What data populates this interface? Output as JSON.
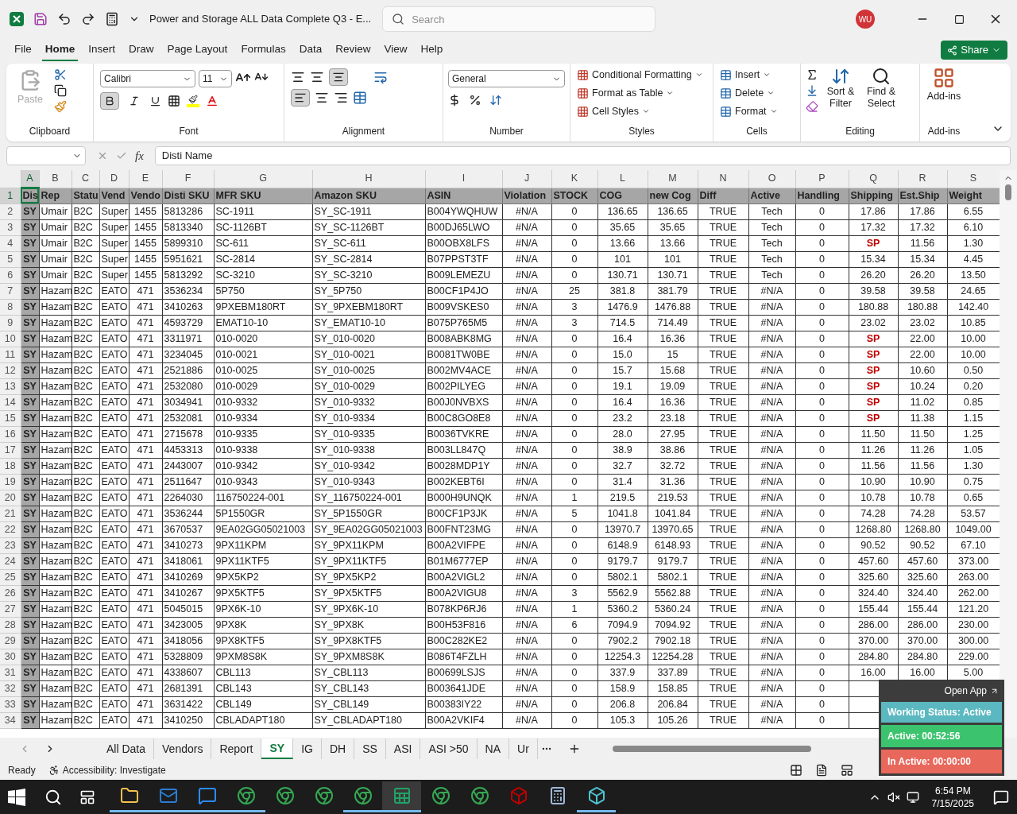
{
  "title_bar": {
    "document_title": "Power and Storage ALL Data Complete Q3  -  E...",
    "search_placeholder": "Search",
    "user_initials": "WU"
  },
  "menu_tabs": [
    {
      "label": "File",
      "selected": false
    },
    {
      "label": "Home",
      "selected": true
    },
    {
      "label": "Insert",
      "selected": false
    },
    {
      "label": "Draw",
      "selected": false
    },
    {
      "label": "Page Layout",
      "selected": false
    },
    {
      "label": "Formulas",
      "selected": false
    },
    {
      "label": "Data",
      "selected": false
    },
    {
      "label": "Review",
      "selected": false
    },
    {
      "label": "View",
      "selected": false
    },
    {
      "label": "Help",
      "selected": false
    }
  ],
  "share_button": "Share",
  "ribbon": {
    "paste": {
      "label": "Paste",
      "disabled": true
    },
    "font_name": "Calibri",
    "font_size": "11",
    "bold": true,
    "italic": false,
    "align_left": true,
    "align_bottom": true,
    "number_format": "General",
    "styles": [
      "Conditional Formatting",
      "Format as Table",
      "Cell Styles"
    ],
    "cells": [
      "Insert",
      "Delete",
      "Format"
    ],
    "sort_filter": "Sort & Filter",
    "find_select": "Find & Select",
    "addins": "Add-ins",
    "groups": [
      "Clipboard",
      "Font",
      "Alignment",
      "Number",
      "Styles",
      "Cells",
      "Editing",
      "Add-ins"
    ]
  },
  "formula_bar": {
    "function_label": "fx",
    "content": "Disti Name"
  },
  "columns": [
    {
      "label": "A",
      "selected": true
    },
    {
      "label": "B",
      "selected": false
    },
    {
      "label": "C",
      "selected": false
    },
    {
      "label": "D",
      "selected": false
    },
    {
      "label": "E",
      "selected": false
    },
    {
      "label": "F",
      "selected": false
    },
    {
      "label": "G",
      "selected": false
    },
    {
      "label": "H",
      "selected": false
    },
    {
      "label": "I",
      "selected": false
    },
    {
      "label": "J",
      "selected": false
    },
    {
      "label": "K",
      "selected": false
    },
    {
      "label": "L",
      "selected": false
    },
    {
      "label": "M",
      "selected": false
    },
    {
      "label": "N",
      "selected": false
    },
    {
      "label": "O",
      "selected": false
    },
    {
      "label": "P",
      "selected": false
    },
    {
      "label": "Q",
      "selected": false
    },
    {
      "label": "R",
      "selected": false
    },
    {
      "label": "S",
      "selected": false
    }
  ],
  "header_row": {
    "number": "1",
    "selected": true,
    "cells": [
      "Dis",
      "Rep",
      "Statu",
      "Vend",
      "Vendo",
      "Disti SKU",
      "MFR SKU",
      "Amazon SKU",
      "ASIN",
      "Violation",
      "STOCK",
      "COG",
      "new Cog",
      "Diff",
      "Active",
      "Handling",
      "Shipping",
      "Est.Ship",
      "Weight"
    ]
  },
  "rows": [
    {
      "number": "2",
      "shipping_flag": false,
      "cells": [
        "SY",
        "Umair",
        "B2C",
        "Super",
        "1455",
        "5813286",
        "SC-1911",
        "SY_SC-1911",
        "B004YWQHUW",
        "#N/A",
        "0",
        "136.65",
        "136.65",
        "TRUE",
        "Tech",
        "0",
        "17.86",
        "17.86",
        "6.55"
      ]
    },
    {
      "number": "3",
      "shipping_flag": false,
      "cells": [
        "SY",
        "Umair",
        "B2C",
        "Super",
        "1455",
        "5813340",
        "SC-1126BT",
        "SY_SC-1126BT",
        "B00DJ65LWO",
        "#N/A",
        "0",
        "35.65",
        "35.65",
        "TRUE",
        "Tech",
        "0",
        "17.32",
        "17.32",
        "6.10"
      ]
    },
    {
      "number": "4",
      "shipping_flag": true,
      "cells": [
        "SY",
        "Umair",
        "B2C",
        "Super",
        "1455",
        "5899310",
        "SC-611",
        "SY_SC-611",
        "B00OBX8LFS",
        "#N/A",
        "0",
        "13.66",
        "13.66",
        "TRUE",
        "Tech",
        "0",
        "SP",
        "11.56",
        "1.30"
      ]
    },
    {
      "number": "5",
      "shipping_flag": false,
      "cells": [
        "SY",
        "Umair",
        "B2C",
        "Super",
        "1455",
        "5951621",
        "SC-2814",
        "SY_SC-2814",
        "B07PPST3TF",
        "#N/A",
        "0",
        "101",
        "101",
        "TRUE",
        "Tech",
        "0",
        "15.34",
        "15.34",
        "4.45"
      ]
    },
    {
      "number": "6",
      "shipping_flag": false,
      "cells": [
        "SY",
        "Umair",
        "B2C",
        "Super",
        "1455",
        "5813292",
        "SC-3210",
        "SY_SC-3210",
        "B009LEMEZU",
        "#N/A",
        "0",
        "130.71",
        "130.71",
        "TRUE",
        "Tech",
        "0",
        "26.20",
        "26.20",
        "13.50"
      ]
    },
    {
      "number": "7",
      "shipping_flag": false,
      "cells": [
        "SY",
        "Hazam",
        "B2C",
        "EATO",
        "471",
        "3536234",
        "5P750",
        "SY_5P750",
        "B00CF1P4JO",
        "#N/A",
        "25",
        "381.8",
        "381.79",
        "TRUE",
        "#N/A",
        "0",
        "39.58",
        "39.58",
        "24.65"
      ]
    },
    {
      "number": "8",
      "shipping_flag": false,
      "cells": [
        "SY",
        "Hazam",
        "B2C",
        "EATO",
        "471",
        "3410263",
        "9PXEBM180RT",
        "SY_9PXEBM180RT",
        "B009VSKES0",
        "#N/A",
        "3",
        "1476.9",
        "1476.88",
        "TRUE",
        "#N/A",
        "0",
        "180.88",
        "180.88",
        "142.40"
      ]
    },
    {
      "number": "9",
      "shipping_flag": false,
      "cells": [
        "SY",
        "Hazam",
        "B2C",
        "EATO",
        "471",
        "4593729",
        "EMAT10-10",
        "SY_EMAT10-10",
        "B075P765M5",
        "#N/A",
        "3",
        "714.5",
        "714.49",
        "TRUE",
        "#N/A",
        "0",
        "23.02",
        "23.02",
        "10.85"
      ]
    },
    {
      "number": "10",
      "shipping_flag": true,
      "cells": [
        "SY",
        "Hazam",
        "B2C",
        "EATO",
        "471",
        "3311971",
        "010-0020",
        "SY_010-0020",
        "B008ABK8MG",
        "#N/A",
        "0",
        "16.4",
        "16.36",
        "TRUE",
        "#N/A",
        "0",
        "SP",
        "22.00",
        "10.00"
      ]
    },
    {
      "number": "11",
      "shipping_flag": true,
      "cells": [
        "SY",
        "Hazam",
        "B2C",
        "EATO",
        "471",
        "3234045",
        "010-0021",
        "SY_010-0021",
        "B0081TW0BE",
        "#N/A",
        "0",
        "15.0",
        "15",
        "TRUE",
        "#N/A",
        "0",
        "SP",
        "22.00",
        "10.00"
      ]
    },
    {
      "number": "12",
      "shipping_flag": true,
      "cells": [
        "SY",
        "Hazam",
        "B2C",
        "EATO",
        "471",
        "2521886",
        "010-0025",
        "SY_010-0025",
        "B002MV4ACE",
        "#N/A",
        "0",
        "15.7",
        "15.68",
        "TRUE",
        "#N/A",
        "0",
        "SP",
        "10.60",
        "0.50"
      ]
    },
    {
      "number": "13",
      "shipping_flag": true,
      "cells": [
        "SY",
        "Hazam",
        "B2C",
        "EATO",
        "471",
        "2532080",
        "010-0029",
        "SY_010-0029",
        "B002PILYEG",
        "#N/A",
        "0",
        "19.1",
        "19.09",
        "TRUE",
        "#N/A",
        "0",
        "SP",
        "10.24",
        "0.20"
      ]
    },
    {
      "number": "14",
      "shipping_flag": true,
      "cells": [
        "SY",
        "Hazam",
        "B2C",
        "EATO",
        "471",
        "3034941",
        "010-9332",
        "SY_010-9332",
        "B00J0NVBXS",
        "#N/A",
        "0",
        "16.4",
        "16.36",
        "TRUE",
        "#N/A",
        "0",
        "SP",
        "11.02",
        "0.85"
      ]
    },
    {
      "number": "15",
      "shipping_flag": true,
      "cells": [
        "SY",
        "Hazam",
        "B2C",
        "EATO",
        "471",
        "2532081",
        "010-9334",
        "SY_010-9334",
        "B00C8GO8E8",
        "#N/A",
        "0",
        "23.2",
        "23.18",
        "TRUE",
        "#N/A",
        "0",
        "SP",
        "11.38",
        "1.15"
      ]
    },
    {
      "number": "16",
      "shipping_flag": false,
      "cells": [
        "SY",
        "Hazam",
        "B2C",
        "EATO",
        "471",
        "2715678",
        "010-9335",
        "SY_010-9335",
        "B0036TVKRE",
        "#N/A",
        "0",
        "28.0",
        "27.95",
        "TRUE",
        "#N/A",
        "0",
        "11.50",
        "11.50",
        "1.25"
      ]
    },
    {
      "number": "17",
      "shipping_flag": false,
      "cells": [
        "SY",
        "Hazam",
        "B2C",
        "EATO",
        "471",
        "4453313",
        "010-9338",
        "SY_010-9338",
        "B003LL847Q",
        "#N/A",
        "0",
        "38.9",
        "38.86",
        "TRUE",
        "#N/A",
        "0",
        "11.26",
        "11.26",
        "1.05"
      ]
    },
    {
      "number": "18",
      "shipping_flag": false,
      "cells": [
        "SY",
        "Hazam",
        "B2C",
        "EATO",
        "471",
        "2443007",
        "010-9342",
        "SY_010-9342",
        "B0028MDP1Y",
        "#N/A",
        "0",
        "32.7",
        "32.72",
        "TRUE",
        "#N/A",
        "0",
        "11.56",
        "11.56",
        "1.30"
      ]
    },
    {
      "number": "19",
      "shipping_flag": false,
      "cells": [
        "SY",
        "Hazam",
        "B2C",
        "EATO",
        "471",
        "2511647",
        "010-9343",
        "SY_010-9343",
        "B002KEBT6I",
        "#N/A",
        "0",
        "31.4",
        "31.36",
        "TRUE",
        "#N/A",
        "0",
        "10.90",
        "10.90",
        "0.75"
      ]
    },
    {
      "number": "20",
      "shipping_flag": false,
      "cells": [
        "SY",
        "Hazam",
        "B2C",
        "EATO",
        "471",
        "2264030",
        "116750224-001",
        "SY_116750224-001",
        "B000H9UNQK",
        "#N/A",
        "1",
        "219.5",
        "219.53",
        "TRUE",
        "#N/A",
        "0",
        "10.78",
        "10.78",
        "0.65"
      ]
    },
    {
      "number": "21",
      "shipping_flag": false,
      "cells": [
        "SY",
        "Hazam",
        "B2C",
        "EATO",
        "471",
        "3536244",
        "5P1550GR",
        "SY_5P1550GR",
        "B00CF1P3JK",
        "#N/A",
        "5",
        "1041.8",
        "1041.84",
        "TRUE",
        "#N/A",
        "0",
        "74.28",
        "74.28",
        "53.57"
      ]
    },
    {
      "number": "22",
      "shipping_flag": false,
      "cells": [
        "SY",
        "Hazam",
        "B2C",
        "EATO",
        "471",
        "3670537",
        "9EA02GG05021003",
        "SY_9EA02GG05021003",
        "B00FNT23MG",
        "#N/A",
        "0",
        "13970.7",
        "13970.65",
        "TRUE",
        "#N/A",
        "0",
        "1268.80",
        "1268.80",
        "1049.00"
      ]
    },
    {
      "number": "23",
      "shipping_flag": false,
      "cells": [
        "SY",
        "Hazam",
        "B2C",
        "EATO",
        "471",
        "3410273",
        "9PX11KPM",
        "SY_9PX11KPM",
        "B00A2VIFPE",
        "#N/A",
        "0",
        "6148.9",
        "6148.93",
        "TRUE",
        "#N/A",
        "0",
        "90.52",
        "90.52",
        "67.10"
      ]
    },
    {
      "number": "24",
      "shipping_flag": false,
      "cells": [
        "SY",
        "Hazam",
        "B2C",
        "EATO",
        "471",
        "3418061",
        "9PX11KTF5",
        "SY_9PX11KTF5",
        "B01M6777EP",
        "#N/A",
        "0",
        "9179.7",
        "9179.7",
        "TRUE",
        "#N/A",
        "0",
        "457.60",
        "457.60",
        "373.00"
      ]
    },
    {
      "number": "25",
      "shipping_flag": false,
      "cells": [
        "SY",
        "Hazam",
        "B2C",
        "EATO",
        "471",
        "3410269",
        "9PX5KP2",
        "SY_9PX5KP2",
        "B00A2VIGL2",
        "#N/A",
        "0",
        "5802.1",
        "5802.1",
        "TRUE",
        "#N/A",
        "0",
        "325.60",
        "325.60",
        "263.00"
      ]
    },
    {
      "number": "26",
      "shipping_flag": false,
      "cells": [
        "SY",
        "Hazam",
        "B2C",
        "EATO",
        "471",
        "3410267",
        "9PX5KTF5",
        "SY_9PX5KTF5",
        "B00A2VIGU8",
        "#N/A",
        "3",
        "5562.9",
        "5562.88",
        "TRUE",
        "#N/A",
        "0",
        "324.40",
        "324.40",
        "262.00"
      ]
    },
    {
      "number": "27",
      "shipping_flag": false,
      "cells": [
        "SY",
        "Hazam",
        "B2C",
        "EATO",
        "471",
        "5045015",
        "9PX6K-10",
        "SY_9PX6K-10",
        "B078KP6RJ6",
        "#N/A",
        "1",
        "5360.2",
        "5360.24",
        "TRUE",
        "#N/A",
        "0",
        "155.44",
        "155.44",
        "121.20"
      ]
    },
    {
      "number": "28",
      "shipping_flag": false,
      "cells": [
        "SY",
        "Hazam",
        "B2C",
        "EATO",
        "471",
        "3423005",
        "9PX8K",
        "SY_9PX8K",
        "B00H53F816",
        "#N/A",
        "6",
        "7094.9",
        "7094.92",
        "TRUE",
        "#N/A",
        "0",
        "286.00",
        "286.00",
        "230.00"
      ]
    },
    {
      "number": "29",
      "shipping_flag": false,
      "cells": [
        "SY",
        "Hazam",
        "B2C",
        "EATO",
        "471",
        "3418056",
        "9PX8KTF5",
        "SY_9PX8KTF5",
        "B00C282KE2",
        "#N/A",
        "0",
        "7902.2",
        "7902.18",
        "TRUE",
        "#N/A",
        "0",
        "370.00",
        "370.00",
        "300.00"
      ]
    },
    {
      "number": "30",
      "shipping_flag": false,
      "cells": [
        "SY",
        "Hazam",
        "B2C",
        "EATO",
        "471",
        "5328809",
        "9PXM8S8K",
        "SY_9PXM8S8K",
        "B086T4FZLH",
        "#N/A",
        "0",
        "12254.3",
        "12254.28",
        "TRUE",
        "#N/A",
        "0",
        "284.80",
        "284.80",
        "229.00"
      ]
    },
    {
      "number": "31",
      "shipping_flag": false,
      "cells": [
        "SY",
        "Hazam",
        "B2C",
        "EATO",
        "471",
        "4338607",
        "CBL113",
        "SY_CBL113",
        "B00699LSJS",
        "#N/A",
        "0",
        "337.9",
        "337.89",
        "TRUE",
        "#N/A",
        "0",
        "16.00",
        "16.00",
        "5.00"
      ]
    },
    {
      "number": "32",
      "cells": [
        "SY",
        "Hazam",
        "B2C",
        "EATO",
        "471",
        "2681391",
        "CBL143",
        "SY_CBL143",
        "B003641JDE",
        "#N/A",
        "0",
        "158.9",
        "158.85",
        "TRUE",
        "#N/A",
        "0"
      ]
    },
    {
      "number": "33",
      "cells": [
        "SY",
        "Hazam",
        "B2C",
        "EATO",
        "471",
        "3631422",
        "CBL149",
        "SY_CBL149",
        "B00383IY22",
        "#N/A",
        "0",
        "206.8",
        "206.84",
        "TRUE",
        "#N/A",
        "0"
      ]
    },
    {
      "number": "34",
      "cells": [
        "SY",
        "Hazam",
        "B2C",
        "EATO",
        "471",
        "3410250",
        "CBLADAPT180",
        "SY_CBLADAPT180",
        "B00A2VKIF4",
        "#N/A",
        "0",
        "105.3",
        "105.26",
        "TRUE",
        "#N/A",
        "0"
      ]
    }
  ],
  "sheet_tabs": [
    {
      "label": "All Data",
      "selected": false
    },
    {
      "label": "Vendors",
      "selected": false
    },
    {
      "label": "Report",
      "selected": false
    },
    {
      "label": "SY",
      "selected": true
    },
    {
      "label": "IG",
      "selected": false
    },
    {
      "label": "DH",
      "selected": false
    },
    {
      "label": "SS",
      "selected": false
    },
    {
      "label": "ASI",
      "selected": false
    },
    {
      "label": "ASI >50",
      "selected": false
    },
    {
      "label": "NA",
      "selected": false
    },
    {
      "label": "Ur",
      "selected": false
    }
  ],
  "status_bar": {
    "mode": "Ready",
    "accessibility": "Accessibility: Investigate"
  },
  "tracker_widget": {
    "open_app": "Open App",
    "working_status": "Working Status: Active",
    "active": "Active: 00:52:56",
    "inactive": "In Active: 00:00:00"
  },
  "taskbar": {
    "apps": [
      {
        "kind": "explorer",
        "running": true,
        "selected": false
      },
      {
        "kind": "mail",
        "running": true,
        "selected": false
      },
      {
        "kind": "meeting",
        "running": true,
        "selected": false
      },
      {
        "kind": "browser",
        "running": true,
        "selected": false
      },
      {
        "kind": "browser",
        "running": false,
        "selected": false
      },
      {
        "kind": "browser",
        "running": false,
        "selected": false
      },
      {
        "kind": "browser",
        "running": true,
        "selected": false
      },
      {
        "kind": "sheet",
        "running": true,
        "selected": true
      },
      {
        "kind": "browser",
        "running": false,
        "selected": false
      },
      {
        "kind": "browser",
        "running": false,
        "selected": false
      },
      {
        "kind": "ftp",
        "running": false,
        "selected": false
      },
      {
        "kind": "calculator",
        "running": false,
        "selected": false
      },
      {
        "kind": "cube",
        "running": true,
        "selected": false
      }
    ],
    "time": "6:54 PM",
    "date": "7/15/2025"
  }
}
